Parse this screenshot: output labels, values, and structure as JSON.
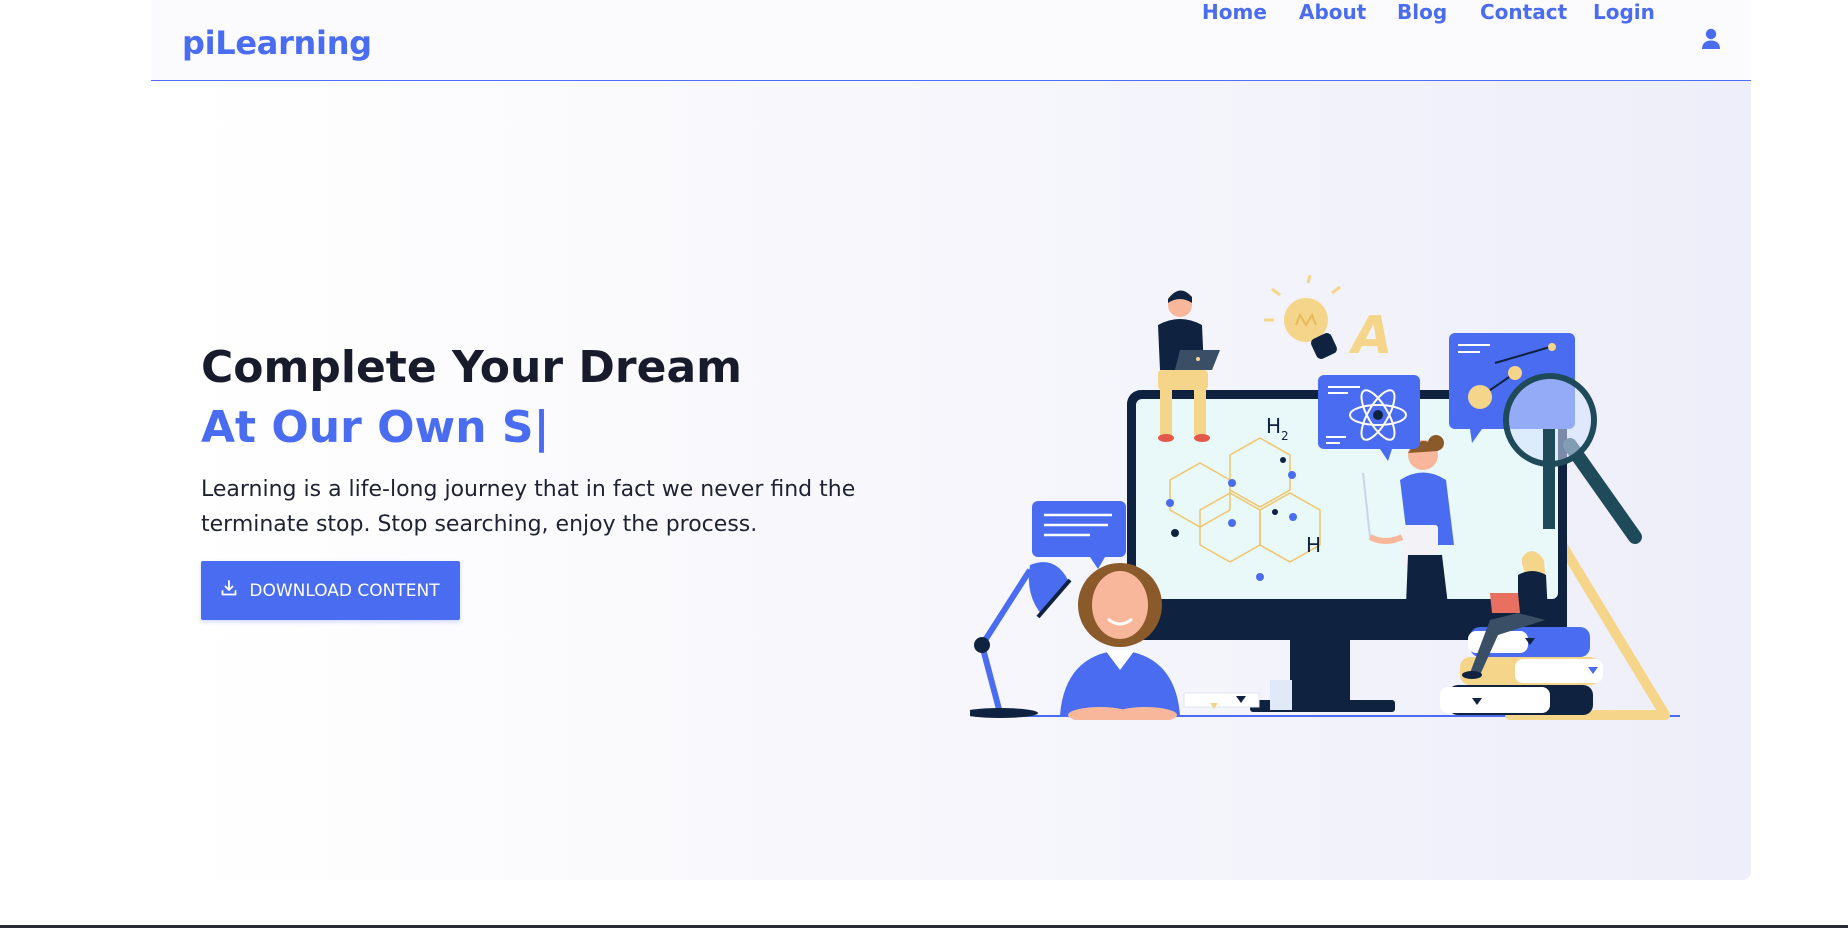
{
  "brand": {
    "name": "piLearning"
  },
  "nav": {
    "items": [
      {
        "label": "Home"
      },
      {
        "label": "About"
      },
      {
        "label": "Blog"
      },
      {
        "label": "Contact"
      },
      {
        "label": "Login"
      }
    ],
    "user_icon": "user-icon"
  },
  "hero": {
    "title": "Complete Your Dream",
    "typed": "At Our Own S|",
    "description": "Learning is a life-long journey that in fact we never find the terminate stop. Stop searching, enjoy the process.",
    "download_label": "DOWNLOAD CONTENT",
    "download_icon": "download-icon"
  },
  "illustration": {
    "formula_h2": "H",
    "formula_sub": "2",
    "formula_h": "H",
    "letter": "A"
  },
  "colors": {
    "accent": "#4a6cf0",
    "dark": "#181b2b",
    "navy": "#0f2340"
  }
}
